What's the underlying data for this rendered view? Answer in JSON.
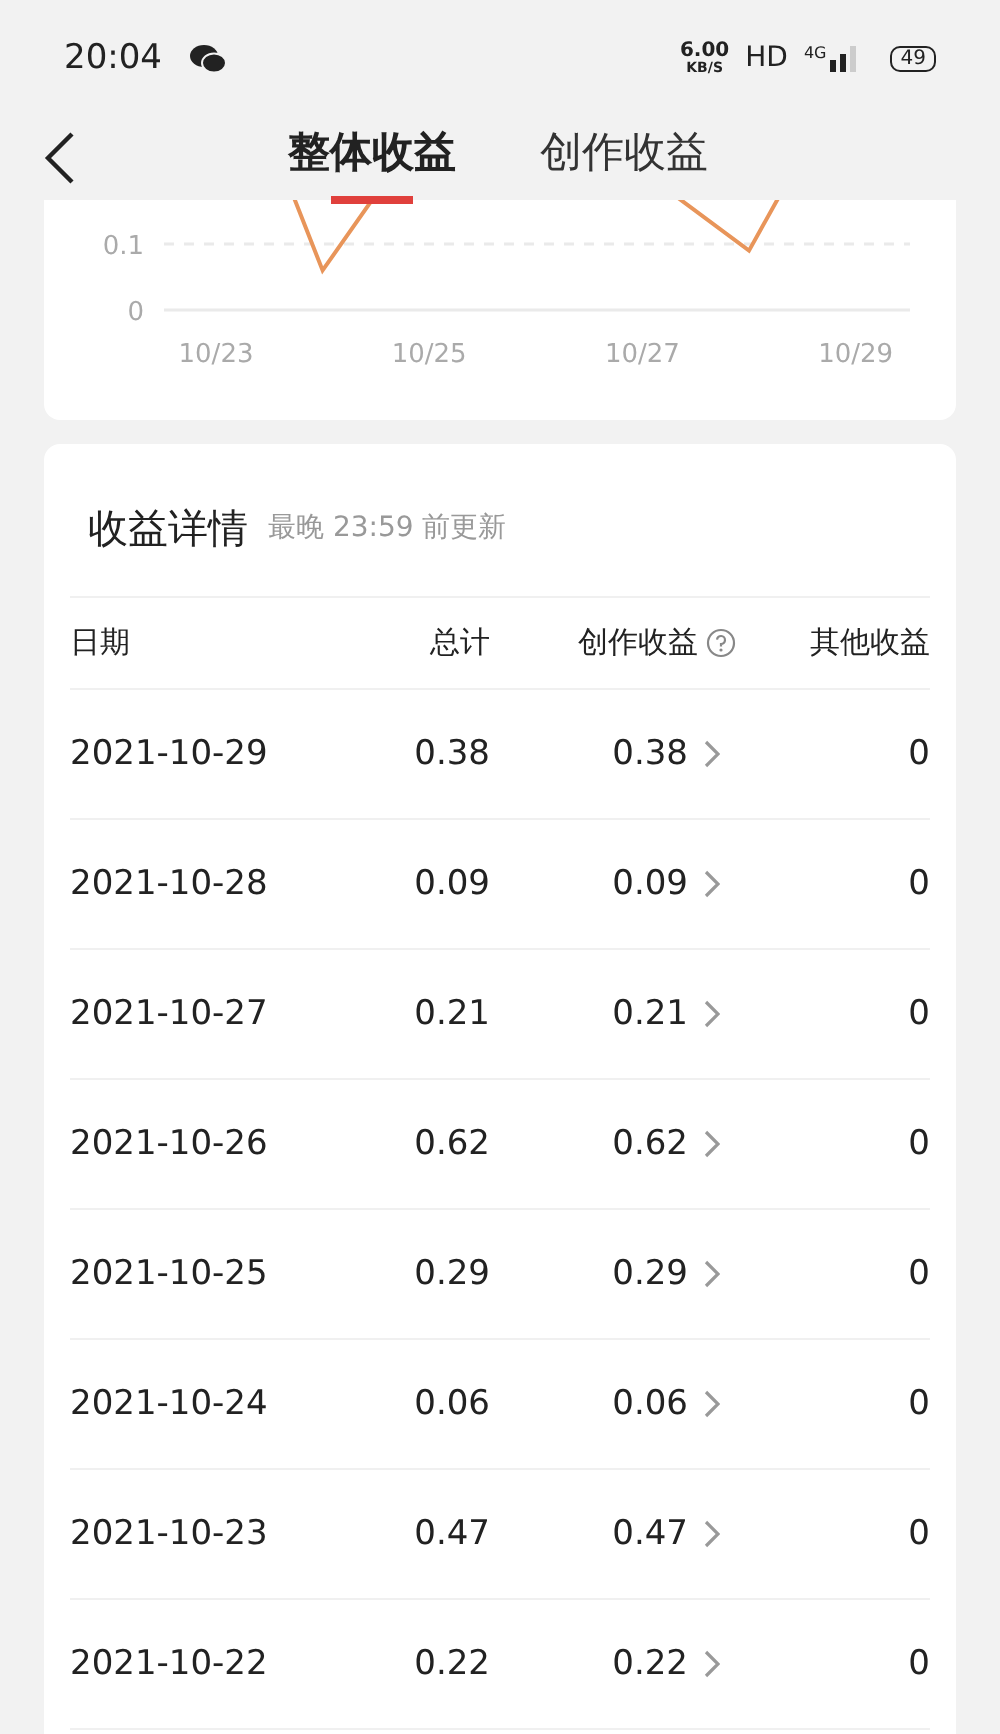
{
  "status_bar": {
    "time": "20:04",
    "net_speed": "6.00",
    "net_unit": "KB/S",
    "hd": "HD",
    "network": "4G",
    "battery": "49"
  },
  "header": {
    "tabs": [
      {
        "label": "整体收益",
        "selected": true
      },
      {
        "label": "创作收益",
        "selected": false
      }
    ]
  },
  "chart": {
    "y_labels": [
      "0.1",
      "0"
    ],
    "x_labels": [
      "10/23",
      "10/25",
      "10/27",
      "10/29"
    ]
  },
  "details": {
    "title": "收益详情",
    "subtitle": "最晚 23:59 前更新",
    "columns": [
      {
        "label": "日期",
        "help": false
      },
      {
        "label": "总计",
        "help": false
      },
      {
        "label": "创作收益",
        "help": true
      },
      {
        "label": "其他收益",
        "help": false
      }
    ],
    "rows": [
      {
        "date": "2021-10-29",
        "total": "0.38",
        "creative": "0.38",
        "other": "0"
      },
      {
        "date": "2021-10-28",
        "total": "0.09",
        "creative": "0.09",
        "other": "0"
      },
      {
        "date": "2021-10-27",
        "total": "0.21",
        "creative": "0.21",
        "other": "0"
      },
      {
        "date": "2021-10-26",
        "total": "0.62",
        "creative": "0.62",
        "other": "0"
      },
      {
        "date": "2021-10-25",
        "total": "0.29",
        "creative": "0.29",
        "other": "0"
      },
      {
        "date": "2021-10-24",
        "total": "0.06",
        "creative": "0.06",
        "other": "0"
      },
      {
        "date": "2021-10-23",
        "total": "0.47",
        "creative": "0.47",
        "other": "0"
      },
      {
        "date": "2021-10-22",
        "total": "0.22",
        "creative": "0.22",
        "other": "0"
      }
    ]
  }
}
